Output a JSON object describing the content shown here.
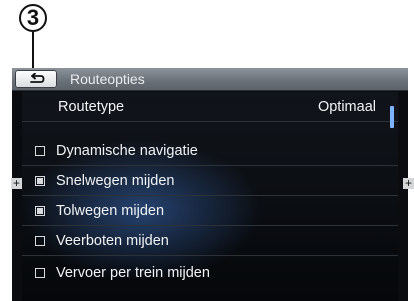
{
  "callout": {
    "number": "3"
  },
  "header": {
    "title": "Routeopties"
  },
  "rows": [
    {
      "label": "Routetype",
      "value": "Optimaal"
    },
    {
      "label": "Dynamische navigatie",
      "checked": false
    },
    {
      "label": "Snelwegen mijden",
      "checked": true
    },
    {
      "label": "Tolwegen mijden",
      "checked": true
    },
    {
      "label": "Veerboten mijden",
      "checked": false
    },
    {
      "label": "Vervoer per trein mijden",
      "checked": false
    }
  ],
  "icons": {
    "back": "back-arrow-icon",
    "scroll_left": "plus-icon",
    "scroll_right": "plus-icon"
  },
  "colors": {
    "highlight": "#3c6ebe",
    "accent": "#7fb2ff"
  }
}
